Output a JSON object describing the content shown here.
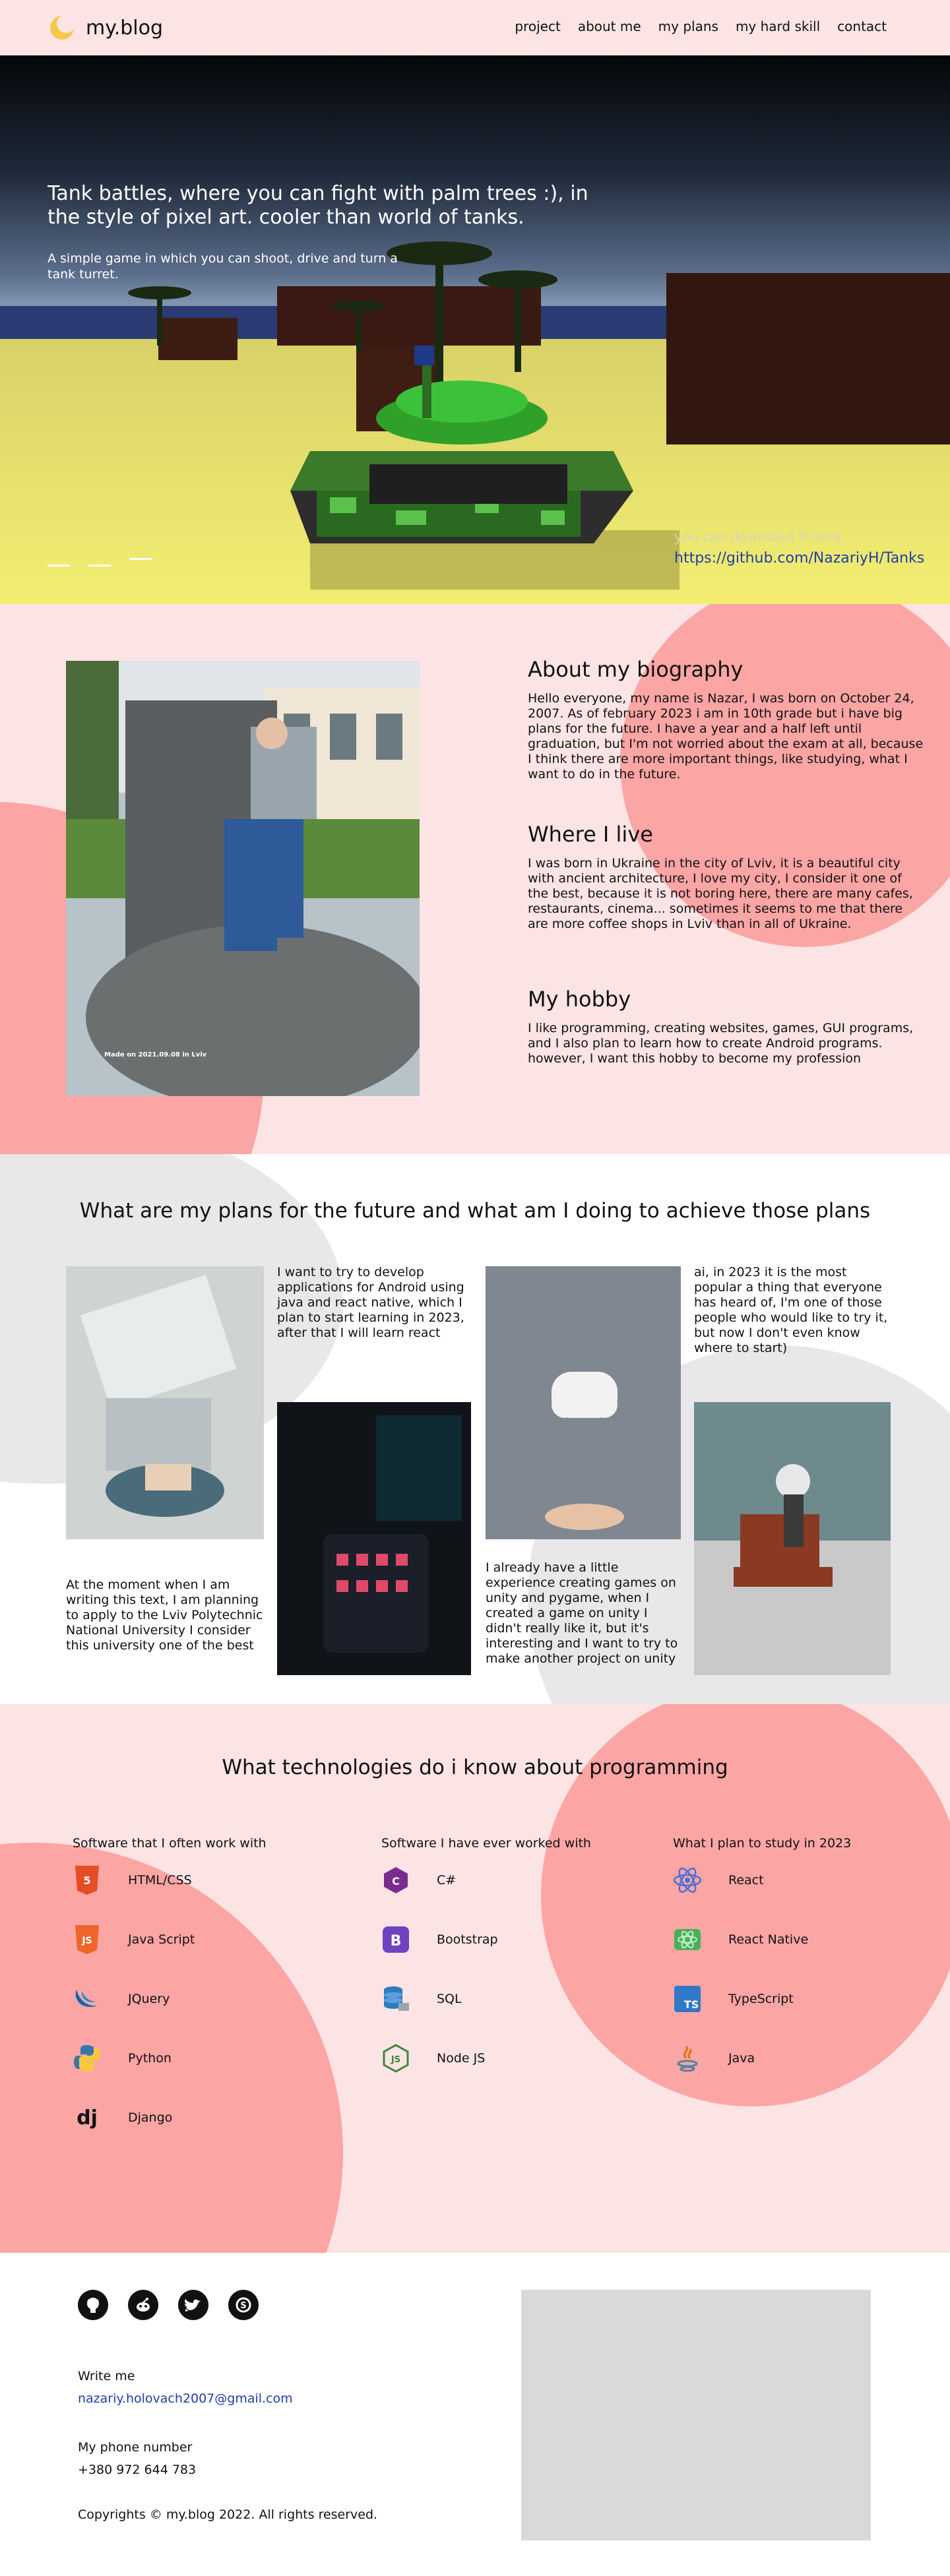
{
  "header": {
    "logo_text": "my.blog",
    "nav": [
      "project",
      "about me",
      "my plans",
      "my hard skill",
      "contact"
    ]
  },
  "hero": {
    "title": "Tank battles, where you can fight with palm trees :), in the style of pixel art. cooler than world of tanks.",
    "subtitle": "A simple game in which you can shoot, drive and turn a tank turret.",
    "download_text": "you can download it here",
    "link_text": "https://github.com/NazariyH/Tanks"
  },
  "bio": {
    "photo_caption": "Made on 2021.09.08 in Lviv",
    "about_title": "About my biography",
    "about_text": "Hello everyone, my name is Nazar, I was born on October 24, 2007. As of february 2023 i am in 10th grade but i have big plans for the future. I have a year and a half left until graduation, but I'm not worried about the exam at all, because I think there are more important things, like studying, what I want to do in the future.",
    "live_title": "Where I live",
    "live_text": "I was born in Ukraine in the city of Lviv, it is a beautiful city with ancient architecture, I love my city, I consider it one of the best, because it is not boring here, there are many cafes, restaurants, cinema... sometimes it seems to me that there are more coffee shops in Lviv than in all of Ukraine.",
    "hobby_title": "My hobby",
    "hobby_text": "I like programming, creating websites, games, GUI programs, and I also plan to learn how to create Android programs. however, I want this hobby to become my profession"
  },
  "plans": {
    "title": "What are my plans for the future and what am I doing to achieve those plans",
    "text_android": "I want to try to develop applications for Android using java and react native, which I plan to start learning in 2023, after that I will learn react",
    "text_ai": "ai, in 2023 it is the most popular a thing that everyone has heard of, I'm one of those people who would like to try it, but now I don't even know where to start)",
    "text_university": "At the moment when I am writing this text, I am planning to apply to the Lviv Polytechnic National University I consider this university one of the best",
    "text_games": "I already have a little experience creating games on unity and pygame, when I created a game on unity I didn't really like it, but it's interesting and I want to try to make another project on unity"
  },
  "tech": {
    "title": "What technologies do i know about programming",
    "columns": [
      {
        "heading": "Software that I often work with",
        "items": [
          {
            "name": "HTML/CSS",
            "icon": "html5-icon",
            "color": "#e44d26"
          },
          {
            "name": "Java Script",
            "icon": "javascript-icon",
            "color": "#f06529"
          },
          {
            "name": "JQuery",
            "icon": "jquery-icon",
            "color": "#0769ad"
          },
          {
            "name": "Python",
            "icon": "python-icon",
            "color": "#3776ab"
          },
          {
            "name": "Django",
            "icon": "django-icon",
            "color": "#111111"
          }
        ]
      },
      {
        "heading": "Software I have ever worked with",
        "items": [
          {
            "name": "C#",
            "icon": "csharp-icon",
            "color": "#7b2a8f"
          },
          {
            "name": "Bootstrap",
            "icon": "bootstrap-icon",
            "color": "#6f42c1"
          },
          {
            "name": "SQL",
            "icon": "database-icon",
            "color": "#2f7bc2"
          },
          {
            "name": "Node JS",
            "icon": "nodejs-icon",
            "color": "#3c873a"
          }
        ]
      },
      {
        "heading": "What I plan to study in 2023",
        "items": [
          {
            "name": "React",
            "icon": "react-icon",
            "color": "#4a6fd8"
          },
          {
            "name": "React Native",
            "icon": "react-native-icon",
            "color": "#2ab24a"
          },
          {
            "name": "TypeScript",
            "icon": "typescript-icon",
            "color": "#3178c6"
          },
          {
            "name": "Java",
            "icon": "java-icon",
            "color": "#e76f00"
          }
        ]
      }
    ]
  },
  "footer": {
    "social": [
      "github-icon",
      "reddit-icon",
      "twitter-icon",
      "skype-icon"
    ],
    "write_label": "Write me",
    "email": "nazariy.holovach2007@gmail.com",
    "phone_label": "My phone number",
    "phone": "+380 972 644 783",
    "copyright": "Copyrights © my.blog 2022. All rights reserved."
  }
}
